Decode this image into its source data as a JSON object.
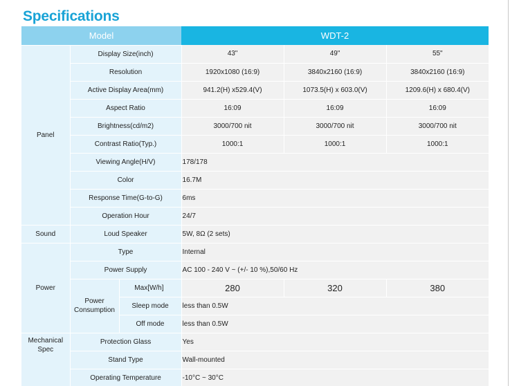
{
  "title": "Specifications",
  "header": {
    "model_label": "Model",
    "model_value": "WDT-2"
  },
  "sizes": [
    "43\"",
    "49\"",
    "55\""
  ],
  "panel": {
    "category": "Panel",
    "display_size_label": "Display Size(inch)",
    "resolution_label": "Resolution",
    "resolution": [
      "1920x1080 (16:9)",
      "3840x2160 (16:9)",
      "3840x2160 (16:9)"
    ],
    "active_area_label": "Active Display Area(mm)",
    "active_area": [
      "941.2(H) x529.4(V)",
      "1073.5(H) x 603.0(V)",
      "1209.6(H) x 680.4(V)"
    ],
    "aspect_label": "Aspect Ratio",
    "aspect": [
      "16:09",
      "16:09",
      "16:09"
    ],
    "brightness_label": "Brightness(cd/m2)",
    "brightness": [
      "3000/700 nit",
      "3000/700 nit",
      "3000/700 nit"
    ],
    "contrast_label": "Contrast Ratio(Typ.)",
    "contrast": [
      "1000:1",
      "1000:1",
      "1000:1"
    ],
    "viewing_label": "Viewing Angle(H/V)",
    "viewing": "178/178",
    "color_label": "Color",
    "color": "16.7M",
    "response_label": "Response Time(G-to-G)",
    "response": "6ms",
    "operation_label": "Operation Hour",
    "operation": "24/7"
  },
  "sound": {
    "category": "Sound",
    "speaker_label": "Loud Speaker",
    "speaker": "5W, 8Ω (2 sets)"
  },
  "power": {
    "category": "Power",
    "type_label": "Type",
    "type": "Internal",
    "supply_label": "Power Supply",
    "supply": "AC 100 - 240 V ~ (+/- 10 %),50/60 Hz",
    "consumption_label": "Power Consumption",
    "max_label": "Max[W/h]",
    "max": [
      "280",
      "320",
      "380"
    ],
    "sleep_label": "Sleep mode",
    "sleep": "less than 0.5W",
    "off_label": "Off mode",
    "off": "less than 0.5W"
  },
  "mechanical": {
    "category": "Mechanical Spec",
    "glass_label": "Protection Glass",
    "glass": "Yes",
    "stand_label": "Stand Type",
    "stand": "Wall-mounted",
    "temp_label": "Operating Temperature",
    "temp": "-10°C ~ 30°C"
  }
}
